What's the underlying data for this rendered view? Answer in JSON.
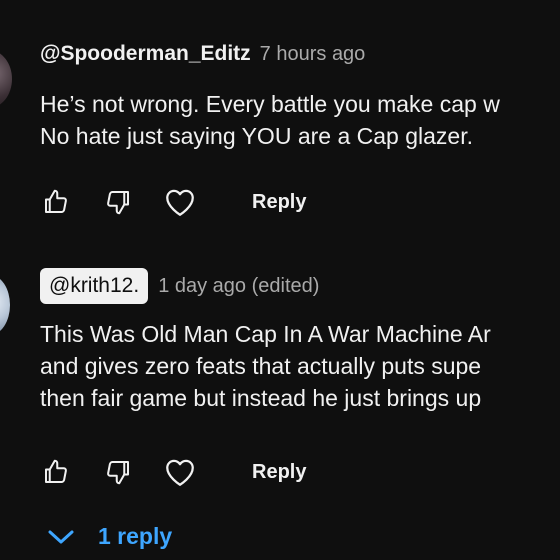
{
  "comments": [
    {
      "author": "@Spooderman_Editz",
      "time": "7 hours ago",
      "lines": [
        "He’s not wrong. Every battle you make cap w",
        "No hate just saying YOU are a Cap glazer."
      ],
      "reply_label": "Reply"
    },
    {
      "author": "@krith12.",
      "time": "1 day ago (edited)",
      "lines": [
        "This Was Old Man Cap In A War Machine Ar",
        "and gives zero feats that actually puts supe",
        "then fair game but instead he just brings up"
      ],
      "reply_label": "Reply"
    }
  ],
  "replies_toggle": {
    "label": "1 reply",
    "icon": "chevron-down-icon"
  },
  "icons": {
    "like": "thumbs-up-icon",
    "dislike": "thumbs-down-icon",
    "heart": "heart-icon"
  },
  "colors": {
    "background": "#0f0f0f",
    "text": "#f1f1f1",
    "secondary_text": "#aaaaaa",
    "link": "#3ea6ff"
  }
}
